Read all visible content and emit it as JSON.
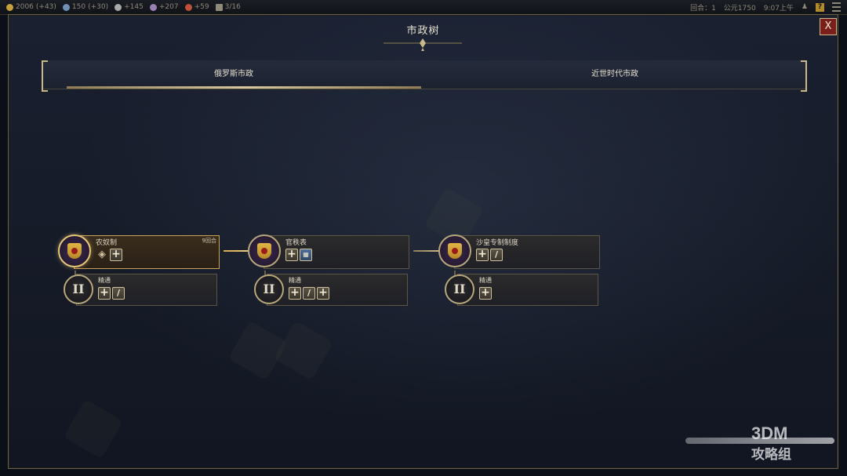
{
  "topbar": {
    "gold": "2006",
    "gold_rate": "(+43)",
    "science": "150",
    "science_rate": "(+30)",
    "faith": "+145",
    "culture": "+207",
    "influence": "+59",
    "settlements": "3/16",
    "turn": "回合：1",
    "year": "公元1750",
    "time": "9:07上午",
    "help": "?"
  },
  "window": {
    "title": "市政树",
    "close_label": "X"
  },
  "tabs": [
    {
      "label": "俄罗斯市政",
      "selected": true
    },
    {
      "label": "近世时代市政",
      "selected": false
    }
  ],
  "civics": [
    {
      "name": "农奴制",
      "turns": "9回合",
      "active": true,
      "icons": [
        "diamond-icon",
        "plus-icon"
      ],
      "mastery": {
        "numeral": "II",
        "name": "精通",
        "icons": [
          "plus-icon",
          "slash-icon"
        ]
      }
    },
    {
      "name": "官秩表",
      "turns": "",
      "active": false,
      "icons": [
        "plus-icon",
        "grid-icon"
      ],
      "mastery": {
        "numeral": "II",
        "name": "精通",
        "icons": [
          "plus-icon",
          "slash-icon",
          "plus-icon"
        ]
      }
    },
    {
      "name": "沙皇专制制度",
      "turns": "",
      "active": false,
      "icons": [
        "plus-icon",
        "slash-icon"
      ],
      "mastery": {
        "numeral": "II",
        "name": "精通",
        "icons": [
          "plus-icon"
        ]
      }
    }
  ],
  "watermark": {
    "line1": "3DM",
    "line2": "攻略组"
  },
  "colors": {
    "accent_gold": "#c9b98a",
    "active_gold": "#e6c77a",
    "close_red": "#7a1f1a",
    "panel_bg": "#161b28"
  }
}
